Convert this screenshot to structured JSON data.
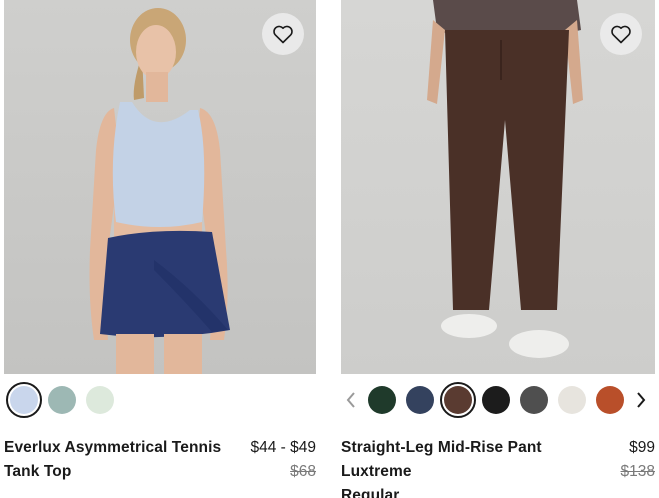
{
  "products": [
    {
      "name_line1": "Everlux Asymmetrical Tennis",
      "name_line2": "Tank Top",
      "price": "$44 - $49",
      "original_price": "$68",
      "favorite_icon": "heart-outline-icon",
      "swatches": [
        {
          "color": "#c9d6ec",
          "label": "light-blue"
        },
        {
          "color": "#9db8b4",
          "label": "sage"
        },
        {
          "color": "#dde9dc",
          "label": "mint"
        }
      ],
      "selected_swatch": 0
    },
    {
      "name_line1": "Straight-Leg Mid-Rise Pant",
      "name_line2": "Luxtreme",
      "name_line3": "Regular",
      "price": "$99",
      "original_price": "$138",
      "favorite_icon": "heart-outline-icon",
      "swatches": [
        {
          "color": "#1f3a2b",
          "label": "dark-green"
        },
        {
          "color": "#34425e",
          "label": "navy"
        },
        {
          "color": "#5a3b31",
          "label": "brown"
        },
        {
          "color": "#1c1c1c",
          "label": "black"
        },
        {
          "color": "#4f4f4f",
          "label": "charcoal"
        },
        {
          "color": "#e7e4de",
          "label": "bone"
        },
        {
          "color": "#b94f2a",
          "label": "rust"
        }
      ],
      "selected_swatch": 2,
      "prev_icon": "chevron-left-icon",
      "next_icon": "chevron-right-icon"
    }
  ]
}
